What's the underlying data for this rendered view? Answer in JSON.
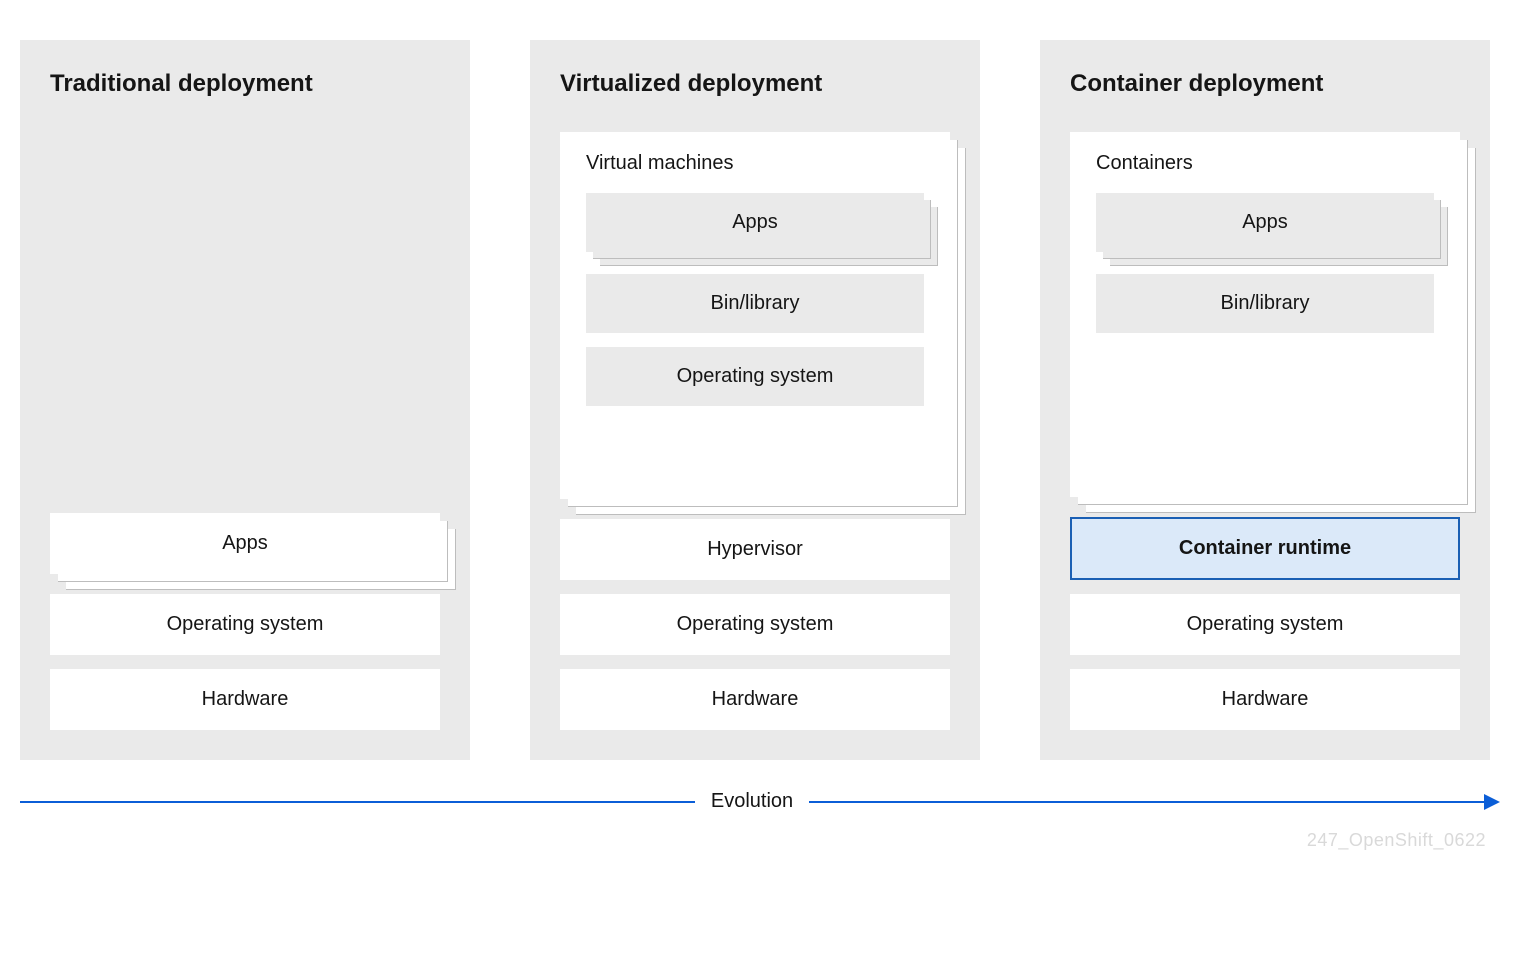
{
  "columns": {
    "traditional": {
      "title": "Traditional deployment",
      "apps": "Apps",
      "os": "Operating system",
      "hardware": "Hardware"
    },
    "virtualized": {
      "title": "Virtualized deployment",
      "vm_label": "Virtual machines",
      "apps": "Apps",
      "bin": "Bin/library",
      "os_inner": "Operating system",
      "hypervisor": "Hypervisor",
      "os": "Operating system",
      "hardware": "Hardware"
    },
    "container": {
      "title": "Container deployment",
      "c_label": "Containers",
      "apps": "Apps",
      "bin": "Bin/library",
      "runtime": "Container runtime",
      "os": "Operating system",
      "hardware": "Hardware"
    }
  },
  "evolution_label": "Evolution",
  "watermark": "247_OpenShift_0622"
}
